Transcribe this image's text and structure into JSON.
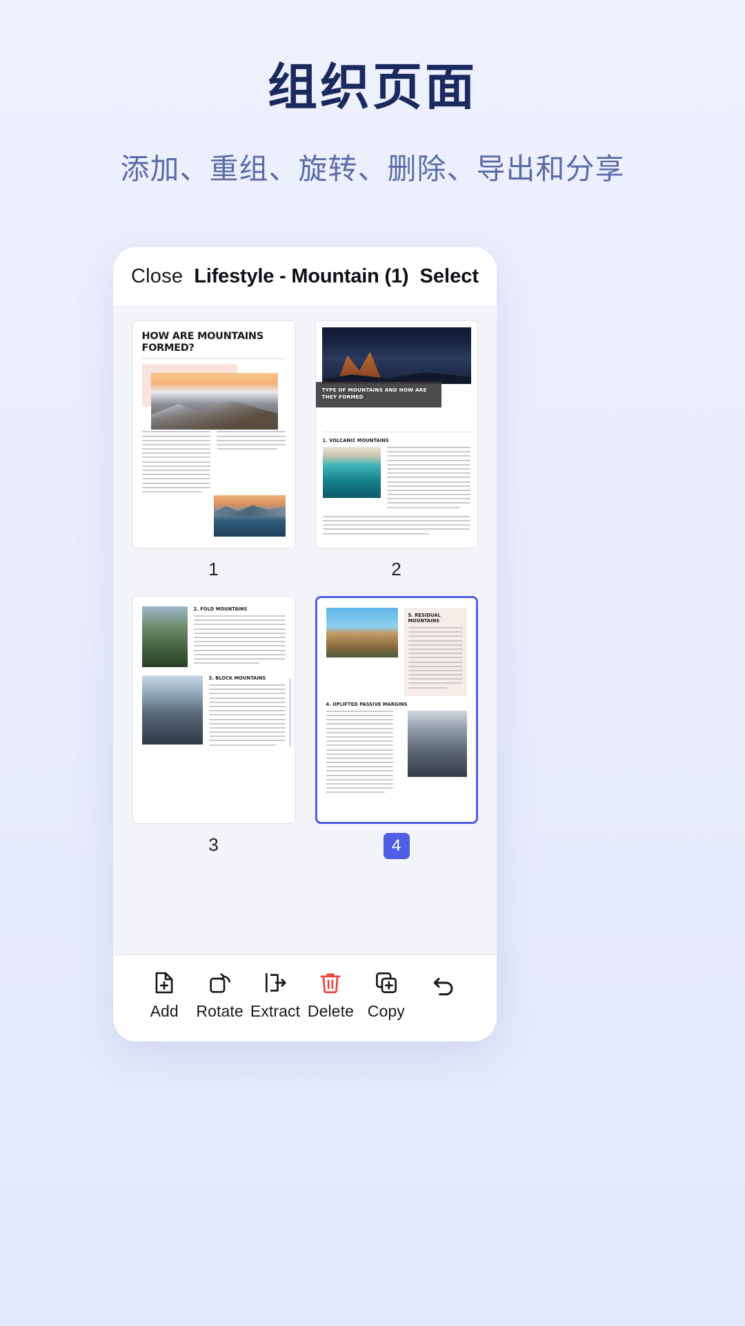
{
  "promo": {
    "title": "组织页面",
    "subtitle": "添加、重组、旋转、删除、导出和分享",
    "title_color": "#1b2a5e",
    "subtitle_color": "#5b6ba8",
    "background_color": "#e9edfb"
  },
  "app": {
    "header": {
      "close_label": "Close",
      "title": "Lifestyle - Mountain (1)",
      "select_label": "Select"
    },
    "accent_color": "#4f5ee4",
    "danger_color": "#e8443a",
    "pages": [
      {
        "number": "1",
        "selected": false,
        "title": "HOW ARE MOUNTAINS FORMED?"
      },
      {
        "number": "2",
        "selected": false,
        "banner": "TYPE OF MOUNTAINS AND HOW ARE THEY FORMED",
        "section": "1. VOLCANIC MOUNTAINS"
      },
      {
        "number": "3",
        "selected": false,
        "section_a": "2. FOLD MOUNTAINS",
        "section_b": "3. BLOCK MOUNTAINS"
      },
      {
        "number": "4",
        "selected": true,
        "section_a": "5. RESIDUAL MOUNTAINS",
        "section_b": "4. UPLIFTED PASSIVE MARGINS"
      }
    ],
    "toolbar": [
      {
        "label": "Add",
        "icon": "add-page-icon"
      },
      {
        "label": "Rotate",
        "icon": "rotate-icon"
      },
      {
        "label": "Extract",
        "icon": "extract-icon"
      },
      {
        "label": "Delete",
        "icon": "trash-icon"
      },
      {
        "label": "Copy",
        "icon": "copy-icon"
      }
    ],
    "undo": {
      "icon": "undo-icon"
    }
  }
}
